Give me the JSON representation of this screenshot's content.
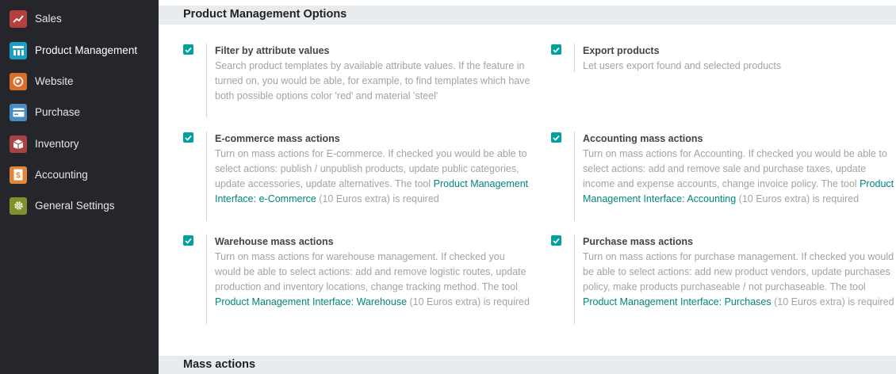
{
  "sidebar": {
    "items": [
      {
        "label": "Sales",
        "icon": "sales-icon",
        "color": "#c0504d"
      },
      {
        "label": "Product Management",
        "icon": "product-management-icon",
        "color": "#1ba1c7"
      },
      {
        "label": "Website",
        "icon": "website-icon",
        "color": "#e07a3a"
      },
      {
        "label": "Purchase",
        "icon": "purchase-icon",
        "color": "#4d8fc4"
      },
      {
        "label": "Inventory",
        "icon": "inventory-icon",
        "color": "#b04545"
      },
      {
        "label": "Accounting",
        "icon": "accounting-icon",
        "color": "#e88b3c"
      },
      {
        "label": "General Settings",
        "icon": "settings-icon",
        "color": "#8a9b2e"
      }
    ],
    "active": "Product Management"
  },
  "main": {
    "section_title": "Product Management Options",
    "next_section_title": "Mass actions",
    "options": {
      "filter": {
        "checked": true,
        "title": "Filter by attribute values",
        "desc": "Search product templates by available attribute values. If the feature in turned on, you would be able, for example, to find templates which have both possible options color 'red' and material 'steel'"
      },
      "export": {
        "checked": true,
        "title": "Export products",
        "desc": "Let users export found and selected products"
      },
      "ecommerce": {
        "checked": true,
        "title": "E-commerce mass actions",
        "desc": "Turn on mass actions for E-commerce. If checked you would be able to select actions: publish / unpublish products, update public categories, update accessories, update alternatives. The tool ",
        "link": "Product Management Interface: e-Commerce",
        "suffix": " (10 Euros extra) is required"
      },
      "accounting": {
        "checked": true,
        "title": "Accounting mass actions",
        "desc": "Turn on mass actions for Accounting. If checked you would be able to select actions: add and remove sale and purchase taxes, update income and expense accounts, change invoice policy. The tool ",
        "link": "Product Management Interface: Accounting",
        "suffix": " (10 Euros extra) is required"
      },
      "warehouse": {
        "checked": true,
        "title": "Warehouse mass actions",
        "desc": "Turn on mass actions for warehouse management. If checked you would be able to select actions: add and remove logistic routes, update production and inventory locations, change tracking method. The tool ",
        "link": "Product Management Interface: Warehouse",
        "suffix": " (10 Euros extra) is required"
      },
      "purchase": {
        "checked": true,
        "title": "Purchase mass actions",
        "desc": "Turn on mass actions for purchase management. If checked you would be able to select actions: add new product vendors, update purchases policy, make products purchaseable / not purchaseable. The tool ",
        "link": "Product Management Interface: Purchases",
        "suffix": " (10 Euros extra) is required"
      }
    },
    "accent_color": "#00a09d"
  }
}
